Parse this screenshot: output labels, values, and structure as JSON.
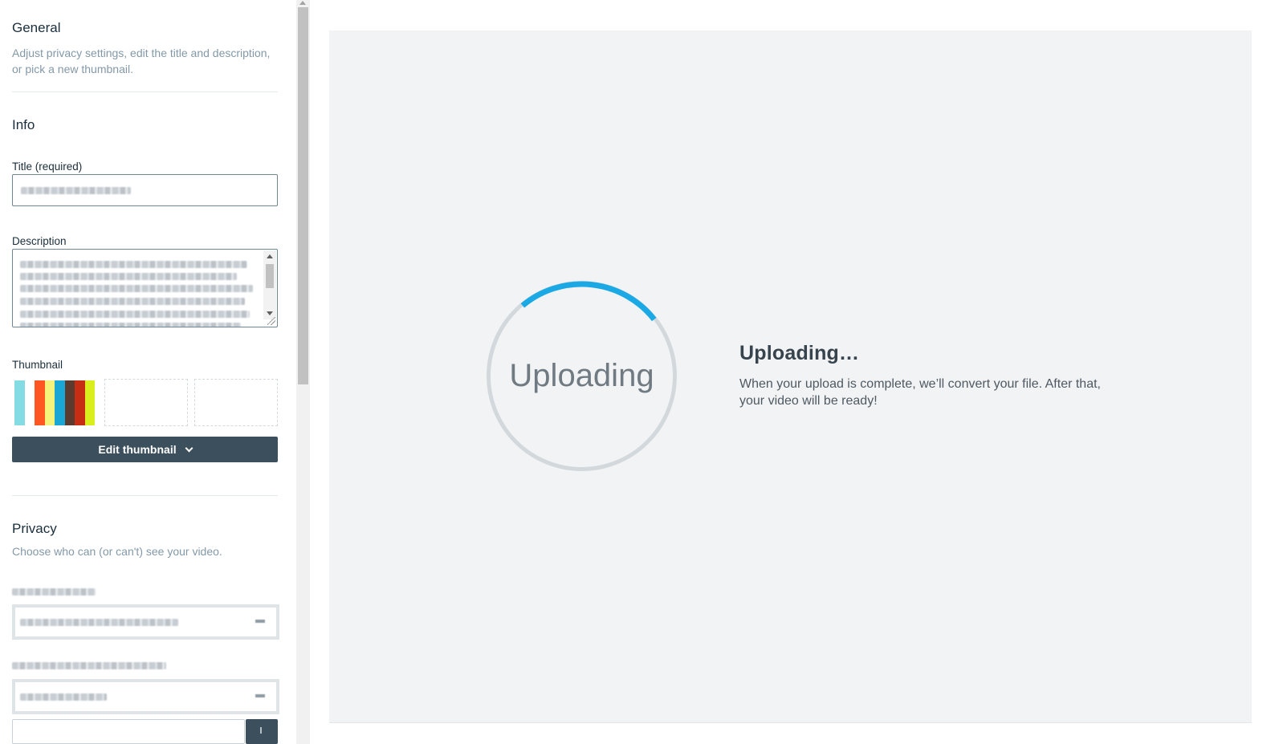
{
  "general": {
    "title": "General",
    "description": "Adjust privacy settings, edit the title and description, or pick a new thumbnail."
  },
  "info": {
    "title": "Info",
    "title_label": "Title (required)",
    "description_label": "Description",
    "thumbnail_label": "Thumbnail",
    "thumbnail_colors": [
      "#84dbe3",
      "#ffffff",
      "#ff5722",
      "#f5f37c",
      "#1aa7d6",
      "#5c3a2e",
      "#c62d12",
      "#d9ee1c"
    ],
    "edit_thumbnail_label": "Edit thumbnail"
  },
  "privacy": {
    "title": "Privacy",
    "description": "Choose who can (or can't) see your video."
  },
  "upload": {
    "spinner_label": "Uploading",
    "heading": "Uploading…",
    "message": "When your upload is complete, we’ll convert your file. After that, your video will be ready!",
    "accent_color": "#1ba9e5",
    "track_color": "#d2d8dc"
  }
}
